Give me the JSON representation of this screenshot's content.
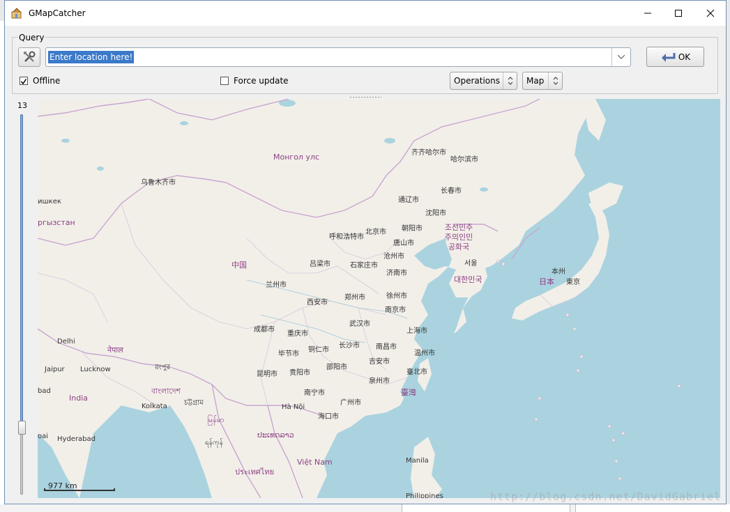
{
  "window": {
    "title": "GMapCatcher"
  },
  "query": {
    "frame_label": "Query",
    "location_value": "Enter location here!",
    "ok_label": "OK",
    "offline_label": "Offline",
    "offline_checked": true,
    "force_update_label": "Force update",
    "force_update_checked": false,
    "operations_value": "Operations",
    "map_value": "Map"
  },
  "zoom": {
    "level": "13"
  },
  "map": {
    "scale_label": "977 km",
    "labels": {
      "mongolia": "Монгол улс",
      "china": "中国",
      "urumqi": "乌鲁木齐市",
      "qiqihar": "齐齐哈尔市",
      "harbin": "哈尔滨市",
      "changchun": "长春市",
      "tonghua": "通辽市",
      "shenyang": "沈阳市",
      "beijing": "北京市",
      "chaoyang": "朝阳市",
      "hohhot": "呼和浩特市",
      "tangshan": "唐山市",
      "cangzhou": "沧州市",
      "shijiazhuang": "石家庄市",
      "luliang": "吕梁市",
      "jinan": "济南市",
      "lanzhou": "兰州市",
      "xian": "西安市",
      "zhengzhou": "郑州市",
      "xuzhou": "徐州市",
      "nanjing": "南京市",
      "wuhan": "武汉市",
      "shanghai": "上海市",
      "chengdu": "成都市",
      "chongqing": "重庆市",
      "bijie": "毕节市",
      "tongren": "铜仁市",
      "changsha": "长沙市",
      "nanchang": "南昌市",
      "wenzhou": "温州市",
      "shaoyang": "邵阳市",
      "jian": "吉安市",
      "kunming": "昆明市",
      "guiyang": "贵阳市",
      "quanzhou": "泉州市",
      "taipei": "臺北市",
      "taiwan": "臺灣",
      "nanning": "南宁市",
      "guangzhou": "广州市",
      "hanoi": "Hà Nội",
      "haikou": "海口市",
      "dprk": "조선민주주의인민공화국",
      "seoul": "서울",
      "korea": "대한민국",
      "japan_honshu": "本州",
      "japan": "日本",
      "tokyo": "東京",
      "delhi": "Delhi",
      "nepal": "नेपाल",
      "jaipur": "Jaipur",
      "lucknow": "Lucknow",
      "india": "India",
      "kolkata": "Kolkata",
      "bangladesh": "বাংলাদেশ",
      "hyderabad": "Hyderabad",
      "myanmar": "မြန်မာ",
      "laos": "ປະເທດລາວ",
      "thailand": "ประเทศไทย",
      "vietnam": "Việt Nam",
      "manila": "Manila",
      "kyrgyzstan": "ргызстан",
      "bishkek": "ишкек",
      "bad": "bad",
      "oai": "oai",
      "rangpur": "রংপুর",
      "chittagong": "চট্টগ্রাম",
      "mandalay": "ရန်ကုန်",
      "nhalhe": "ᴴ",
      "philippines": "Philippines"
    }
  },
  "watermark": "http://blog.csdn.net/DavidGabriel",
  "colors": {
    "water": "#aad3df",
    "land": "#f2efe9",
    "border": "#c8a6cf",
    "selection": "#3b79c9"
  }
}
